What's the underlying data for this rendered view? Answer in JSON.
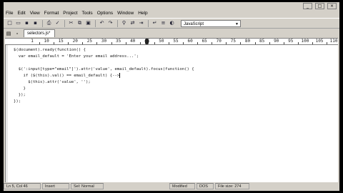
{
  "menu": [
    "File",
    "Edit",
    "View",
    "Format",
    "Project",
    "Tools",
    "Options",
    "Window",
    "Help"
  ],
  "window_controls": {
    "minimize": "_",
    "maximize": "□",
    "close": "×"
  },
  "toolbar": {
    "icons": [
      "new-file-icon",
      "open-folder-icon",
      "save-icon",
      "save-all-icon",
      "print-icon",
      "spell-check-icon",
      "cut-icon",
      "copy-icon",
      "paste-icon",
      "undo-icon",
      "redo-icon",
      "find-icon",
      "replace-icon",
      "go-to-icon",
      "word-wrap-icon",
      "indent-icon",
      "color-icon"
    ],
    "glyphs": [
      "□",
      "▭",
      "▪",
      "▪",
      "⎙",
      "✓",
      "✂",
      "⧉",
      "▣",
      "↶",
      "↷",
      "⚲",
      "⇄",
      "⇥",
      "↵",
      "≡",
      "◐"
    ],
    "language": "JavaScript"
  },
  "tab": {
    "label": "selectors.js*"
  },
  "ruler": {
    "labels": [
      "1",
      "10",
      "15",
      "20",
      "25",
      "30",
      "35",
      "40",
      "45",
      "50",
      "55",
      "60",
      "65",
      "70",
      "75",
      "80",
      "85",
      "90",
      "95",
      "100",
      "105",
      "110"
    ]
  },
  "code_lines": [
    "$(document).ready(function() {",
    "  var email_default = 'Enter your email address...';",
    "",
    "  $(':input[type=\"email\"]').attr('value', email_default).focus(function() {",
    "    if ($(this).val() == email_default) {-->",
    "      $(this).attr('value', '');",
    "    }",
    "  });",
    "});"
  ],
  "status": {
    "position": "Ln 5, Col 46",
    "mode": "Insert",
    "selection": "Sel: Normal",
    "modified": "Modified",
    "line_endings": "DOS",
    "file_size": "File size: 274"
  }
}
